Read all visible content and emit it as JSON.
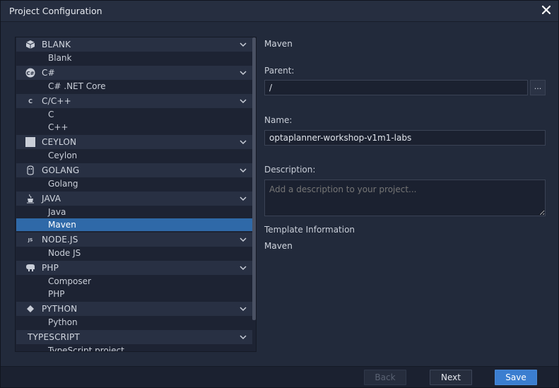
{
  "window": {
    "title": "Project Configuration"
  },
  "tree": {
    "categories": [
      {
        "label": "BLANK",
        "icon": "cube-icon",
        "items": [
          "Blank"
        ]
      },
      {
        "label": "C#",
        "icon": "csharp-icon",
        "items": [
          "C# .NET Core"
        ]
      },
      {
        "label": "C/C++",
        "icon": "c-icon",
        "items": [
          "C",
          "C++"
        ]
      },
      {
        "label": "CEYLON",
        "icon": "ceylon-icon",
        "items": [
          "Ceylon"
        ]
      },
      {
        "label": "GOLANG",
        "icon": "gopher-icon",
        "items": [
          "Golang"
        ]
      },
      {
        "label": "JAVA",
        "icon": "coffee-icon",
        "items": [
          "Java",
          "Maven"
        ]
      },
      {
        "label": "NODE.JS",
        "icon": "nodejs-icon",
        "items": [
          "Node JS"
        ]
      },
      {
        "label": "PHP",
        "icon": "elephant-icon",
        "items": [
          "Composer",
          "PHP"
        ]
      },
      {
        "label": "PYTHON",
        "icon": "python-icon",
        "items": [
          "Python"
        ]
      },
      {
        "label": "TYPESCRIPT",
        "icon": "",
        "items": [
          "TypeScript project"
        ]
      }
    ],
    "selected": "Maven"
  },
  "form": {
    "heading": "Maven",
    "parent_label": "Parent:",
    "parent_value": "/",
    "browse_label": "...",
    "name_label": "Name:",
    "name_value": "optaplanner-workshop-v1m1-labs",
    "description_label": "Description:",
    "description_placeholder": "Add a description to your project...",
    "template_info_label": "Template Information",
    "template_info_value": "Maven"
  },
  "footer": {
    "back_label": "Back",
    "next_label": "Next",
    "save_label": "Save"
  },
  "colors": {
    "accent": "#3b7ed0",
    "selection": "#2f69a8",
    "background": "#222a3b"
  }
}
